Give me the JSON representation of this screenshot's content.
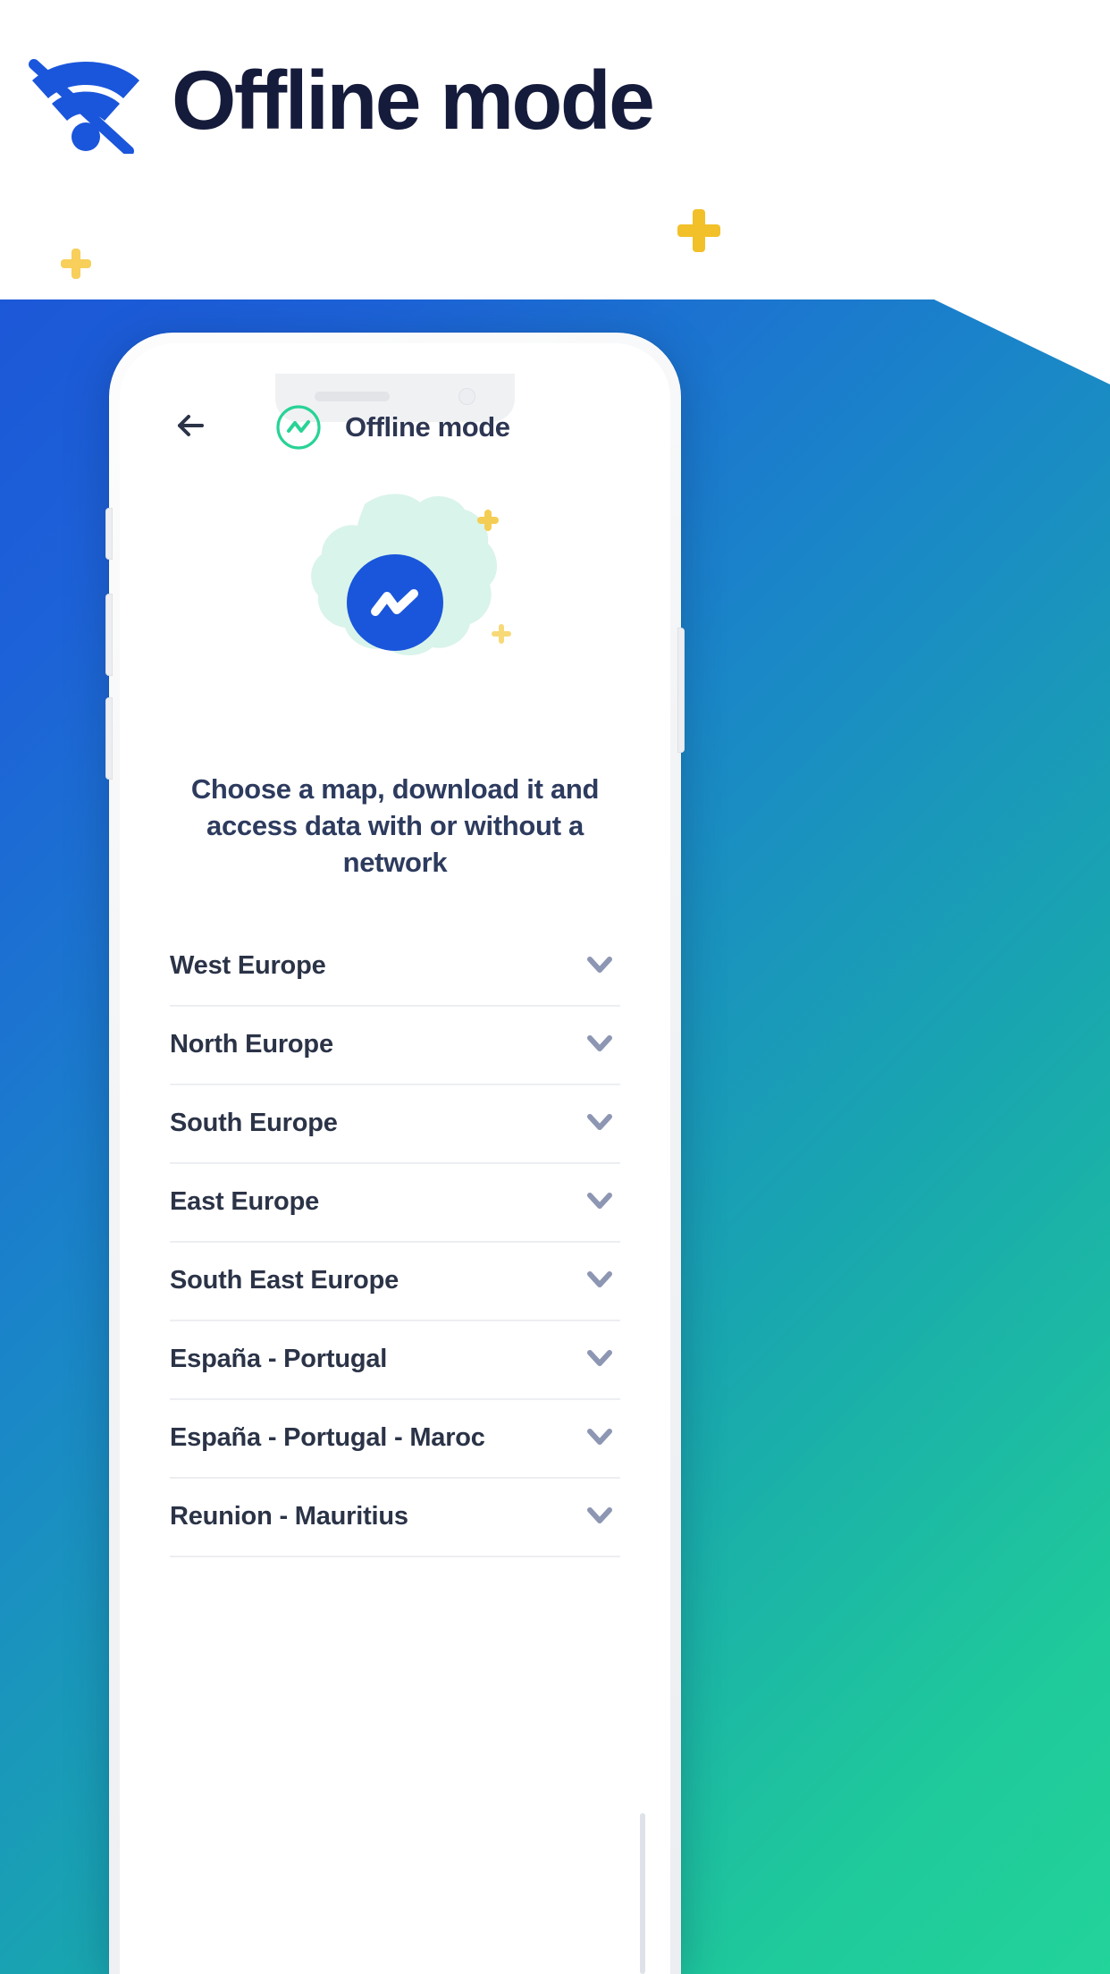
{
  "header": {
    "title": "Offline mode",
    "icon": "wifi-off-icon"
  },
  "decorations": {
    "plus_small_left": "plus-icon",
    "plus_large_right": "plus-icon",
    "hero_plus_top": "plus-icon",
    "hero_plus_bottom": "plus-icon"
  },
  "phone": {
    "app": {
      "navbar": {
        "back_icon": "arrow-left-icon",
        "brand_icon": "brand-logo-icon",
        "title": "Offline mode"
      },
      "hero": {
        "blob_icon": "cloud-blob-shape",
        "badge_icon": "offline-logo-icon"
      },
      "subtitle": "Choose a map, download it and access data with or without a network",
      "regions": [
        {
          "label": "West Europe",
          "chevron": "chevron-down-icon"
        },
        {
          "label": "North Europe",
          "chevron": "chevron-down-icon"
        },
        {
          "label": "South Europe",
          "chevron": "chevron-down-icon"
        },
        {
          "label": "East Europe",
          "chevron": "chevron-down-icon"
        },
        {
          "label": "South East Europe",
          "chevron": "chevron-down-icon"
        },
        {
          "label": "España - Portugal",
          "chevron": "chevron-down-icon"
        },
        {
          "label": "España - Portugal - Maroc",
          "chevron": "chevron-down-icon"
        },
        {
          "label": "Reunion - Mauritius",
          "chevron": "chevron-down-icon"
        }
      ]
    }
  },
  "colors": {
    "brand_blue": "#1a56db",
    "title_navy": "#151b3b",
    "accent_green": "#28d396",
    "accent_yellow": "#f2c029",
    "blob_mint": "#d9f4ea",
    "chevron_gray": "#8d96b2",
    "subtitle_navy": "#2d3b5e",
    "gradient_start": "#1a4fd6",
    "gradient_end": "#22d39a"
  }
}
